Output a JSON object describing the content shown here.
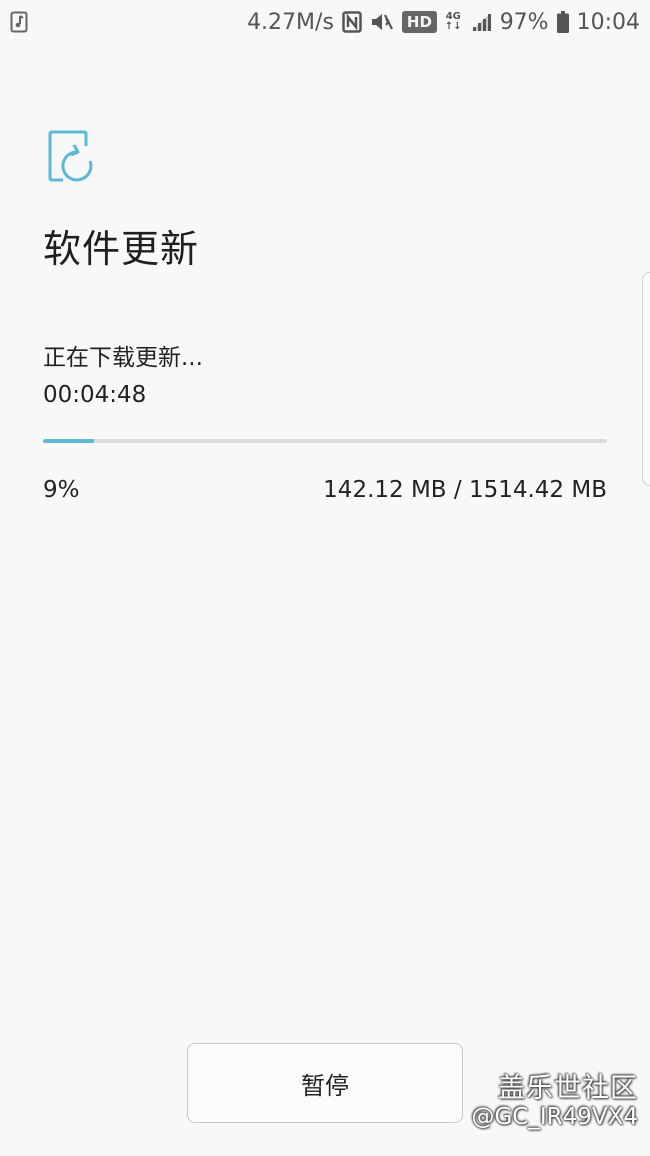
{
  "status_bar": {
    "speed": "4.27M/s",
    "hd": "HD",
    "network_top": "4G",
    "network_bottom": "↑↓",
    "battery": "97%",
    "time": "10:04",
    "icons": [
      "storage-icon",
      "nfc-icon",
      "mute-icon",
      "signal-icon",
      "battery-icon"
    ]
  },
  "page": {
    "icon": "software-update-icon",
    "title": "软件更新",
    "status": "正在下载更新...",
    "elapsed": "00:04:48",
    "progress_percent": 9,
    "percent_label": "9%",
    "size_info": "142.12 MB / 1514.42 MB"
  },
  "actions": {
    "pause_label": "暂停"
  },
  "watermark": {
    "brand": "盖乐世社区",
    "user": "@GC_IR49VX4"
  },
  "colors": {
    "accent": "#5ab9d4",
    "track": "#dcdcdc",
    "background": "#f8f8f8"
  }
}
